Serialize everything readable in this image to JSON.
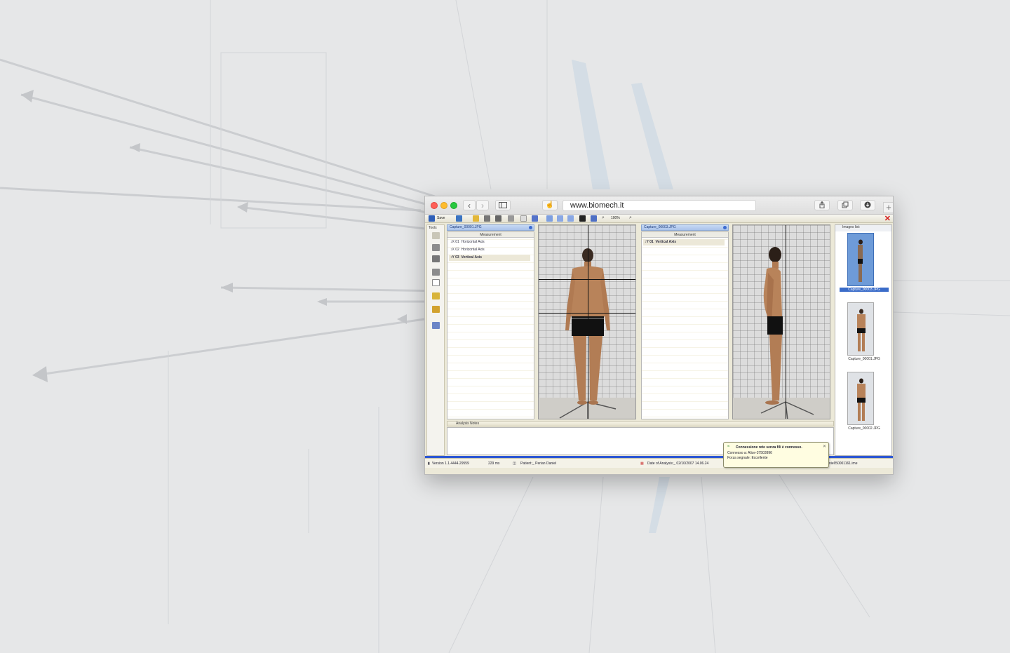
{
  "browser": {
    "url": "www.biomech.it"
  },
  "app": {
    "toolbar": {
      "save_label": "Save",
      "zoom": "100%"
    },
    "tools_title": "Tools",
    "left_panel": {
      "title": "Capture_00001.JPG",
      "table_header": "Measurement",
      "rows": [
        {
          "id": "01",
          "label": "Horizontal Axis"
        },
        {
          "id": "02",
          "label": "Horizontal Axis"
        },
        {
          "id": "03",
          "label": "Vertical Axis"
        }
      ]
    },
    "right_panel": {
      "title": "Capture_00003.JPG",
      "table_header": "Measurement",
      "rows": [
        {
          "id": "01",
          "label": "Vertical Axis"
        }
      ]
    },
    "images_list": {
      "title": "Images list:",
      "items": [
        {
          "label": "Capture_00003.JPG"
        },
        {
          "label": "Capture_00001.JPG"
        },
        {
          "label": "Capture_00002.JPG"
        }
      ]
    },
    "notes_title": "Analysis Notes",
    "status": {
      "version": "Version 1.1.4444.29559",
      "timing": "229 ms",
      "patient": "Patient:_ Perian Daniel",
      "date": "Date of Analysis:_ 02/10/2007 14.06.24",
      "file": "niel\\50001161.ime"
    },
    "balloon": {
      "title": "Connessione rete senza fili è connesso.",
      "line1": "Connesso a: Alice-37503996",
      "line2": "Forza segnale: Eccellente"
    }
  },
  "colors": {
    "accent_blue": "#2d57d3",
    "close_red": "#d41919"
  }
}
